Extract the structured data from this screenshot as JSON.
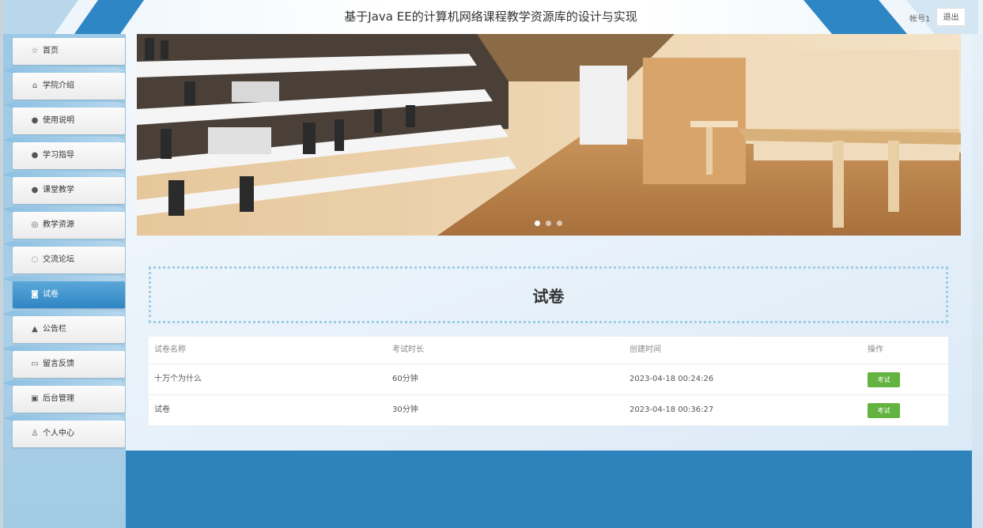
{
  "header": {
    "title": "基于Java EE的计算机网络课程教学资源库的设计与实现",
    "account": "帐号1",
    "logout": "退出"
  },
  "sidebar": {
    "items": [
      {
        "label": "首页",
        "icon": "☆",
        "icon_name": "star-icon"
      },
      {
        "label": "学院介绍",
        "icon": "⌂",
        "icon_name": "home-icon"
      },
      {
        "label": "使用说明",
        "icon": "●",
        "icon_name": "info-icon"
      },
      {
        "label": "学习指导",
        "icon": "●",
        "icon_name": "help-icon"
      },
      {
        "label": "课堂教学",
        "icon": "●",
        "icon_name": "info-icon"
      },
      {
        "label": "教学资源",
        "icon": "◎",
        "icon_name": "resource-icon"
      },
      {
        "label": "交流论坛",
        "icon": "◌",
        "icon_name": "forum-icon"
      },
      {
        "label": "试卷",
        "icon": "◙",
        "icon_name": "camera-icon",
        "active": true
      },
      {
        "label": "公告栏",
        "icon": "▲",
        "icon_name": "bullhorn-icon"
      },
      {
        "label": "留言反馈",
        "icon": "▭",
        "icon_name": "message-icon"
      },
      {
        "label": "后台管理",
        "icon": "▣",
        "icon_name": "admin-icon"
      },
      {
        "label": "个人中心",
        "icon": "♙",
        "icon_name": "user-icon"
      }
    ]
  },
  "carousel": {
    "slide_count": 3,
    "active_index": 0
  },
  "content": {
    "section_title": "试卷",
    "table": {
      "headers": [
        "试卷名称",
        "考试时长",
        "创建时间",
        "操作"
      ],
      "rows": [
        {
          "name": "十万个为什么",
          "duration": "60分钟",
          "created": "2023-04-18 00:24:26",
          "action": "考试"
        },
        {
          "name": "试卷",
          "duration": "30分钟",
          "created": "2023-04-18 00:36:27",
          "action": "考试"
        }
      ]
    }
  },
  "colors": {
    "primary": "#2f86c4",
    "exam_button": "#62b33f",
    "sidebar_bg": "#9cc9e6"
  }
}
